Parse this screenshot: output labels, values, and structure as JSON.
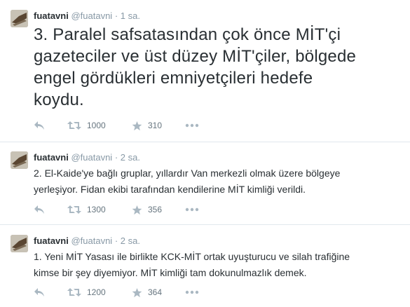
{
  "tweets": [
    {
      "name": "fuatavni",
      "handle": "@fuatavni",
      "separator": "·",
      "time": "1 sa.",
      "text_lines": [
        "3. Paralel safsatasından çok önce MİT'çi",
        "gazeteciler ve üst düzey MİT'çiler, bölgede",
        "engel gördükleri emniyetçileri hedefe",
        "koydu."
      ],
      "retweets": "1000",
      "favorites": "310"
    },
    {
      "name": "fuatavni",
      "handle": "@fuatavni",
      "separator": "·",
      "time": "2 sa.",
      "text_lines": [
        "2. El-Kaide'ye bağlı gruplar, yıllardır Van merkezli olmak üzere bölgeye",
        "yerleşiyor. Fidan ekibi tarafından kendilerine MİT kimliği verildi."
      ],
      "retweets": "1300",
      "favorites": "356"
    },
    {
      "name": "fuatavni",
      "handle": "@fuatavni",
      "separator": "·",
      "time": "2 sa.",
      "text_lines": [
        "1. Yeni MİT Yasası ile birlikte KCK-MİT ortak uyuşturucu ve silah trafiğine",
        "kimse bir şey diyemiyor. MİT kimliği tam dokunulmazlık demek."
      ],
      "retweets": "1200",
      "favorites": "364"
    }
  ],
  "icons": {
    "reply": "reply-icon",
    "retweet": "retweet-icon",
    "favorite": "star-icon",
    "more": "more-icon"
  },
  "colors": {
    "text": "#292f33",
    "muted": "#8899a6",
    "divider": "#e1e8ed"
  }
}
